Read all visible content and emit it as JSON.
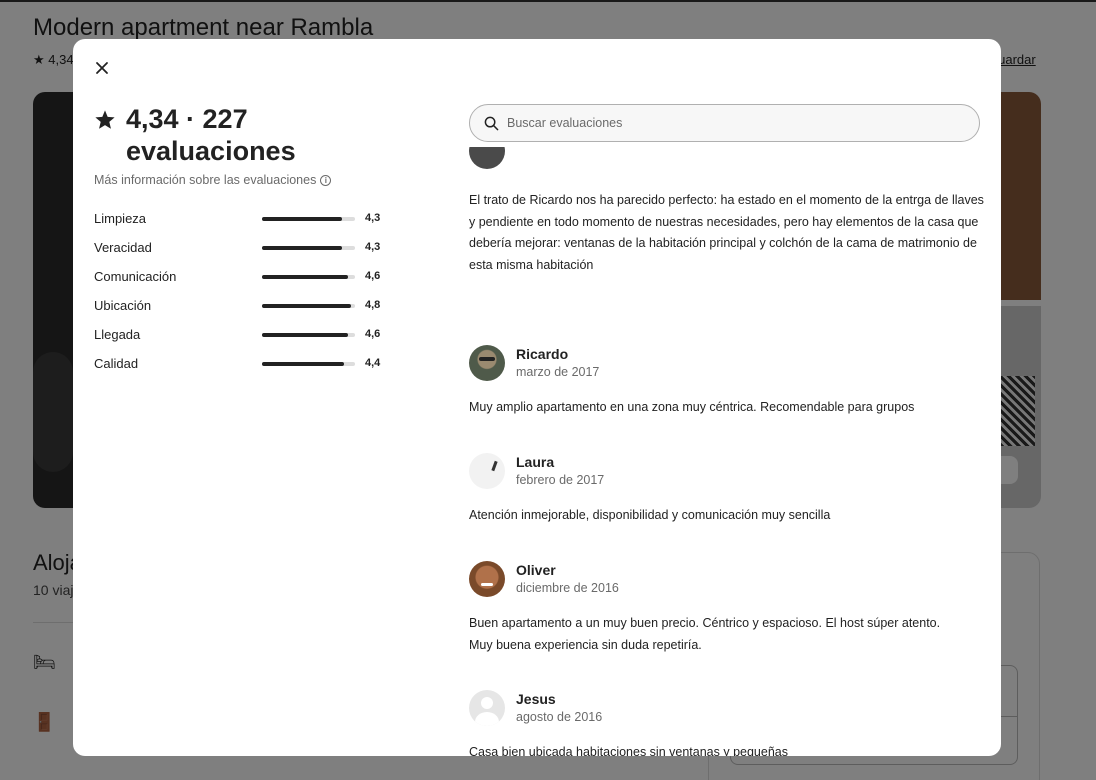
{
  "background": {
    "listing_title": "Modern apartment near Rambla",
    "rating_short": "4,34",
    "save_label": "Guardar",
    "host_title": "Aloja",
    "host_sub": "10 viaj"
  },
  "modal": {
    "overall_rating": "4,34 · 227 evaluaciones",
    "more_info_label": "Más información sobre las evaluaciones",
    "categories": [
      {
        "label": "Limpieza",
        "value": "4,3",
        "score": 4.3
      },
      {
        "label": "Veracidad",
        "value": "4,3",
        "score": 4.3
      },
      {
        "label": "Comunicación",
        "value": "4,6",
        "score": 4.6
      },
      {
        "label": "Ubicación",
        "value": "4,8",
        "score": 4.8
      },
      {
        "label": "Llegada",
        "value": "4,6",
        "score": 4.6
      },
      {
        "label": "Calidad",
        "value": "4,4",
        "score": 4.4
      }
    ],
    "search_placeholder": "Buscar evaluaciones",
    "reviews": [
      {
        "name": "",
        "date": "",
        "text": "El trato de Ricardo nos ha parecido perfecto: ha estado en el momento de la entrga de llaves y pendiente en todo momento de nuestras necesidades, pero hay elementos de la casa que debería mejorar: ventanas de la habitación principal y colchón de la cama de matrimonio de esta misma habitación"
      },
      {
        "name": "Ricardo",
        "date": "marzo de 2017",
        "text": "Muy amplio apartamento en una zona muy céntrica. Recomendable para grupos"
      },
      {
        "name": "Laura",
        "date": "febrero de 2017",
        "text": "Atención inmejorable, disponibilidad y comunicación muy sencilla"
      },
      {
        "name": "Oliver",
        "date": "diciembre de 2016",
        "text": "Buen apartamento a un muy buen precio. Céntrico y espacioso. El host súper atento. Muy buena experiencia sin duda repetiría."
      },
      {
        "name": "Jesus",
        "date": "agosto de 2016",
        "text": "Casa bien ubicada habitaciones sin ventanas y pequeñas\nRelación calidad precio muy cara"
      }
    ]
  },
  "colors": {
    "overlay": "#000000",
    "text_primary": "#222222",
    "text_secondary": "#6a6a6a",
    "bar_fill": "#222222",
    "bar_track": "#dddddd"
  }
}
